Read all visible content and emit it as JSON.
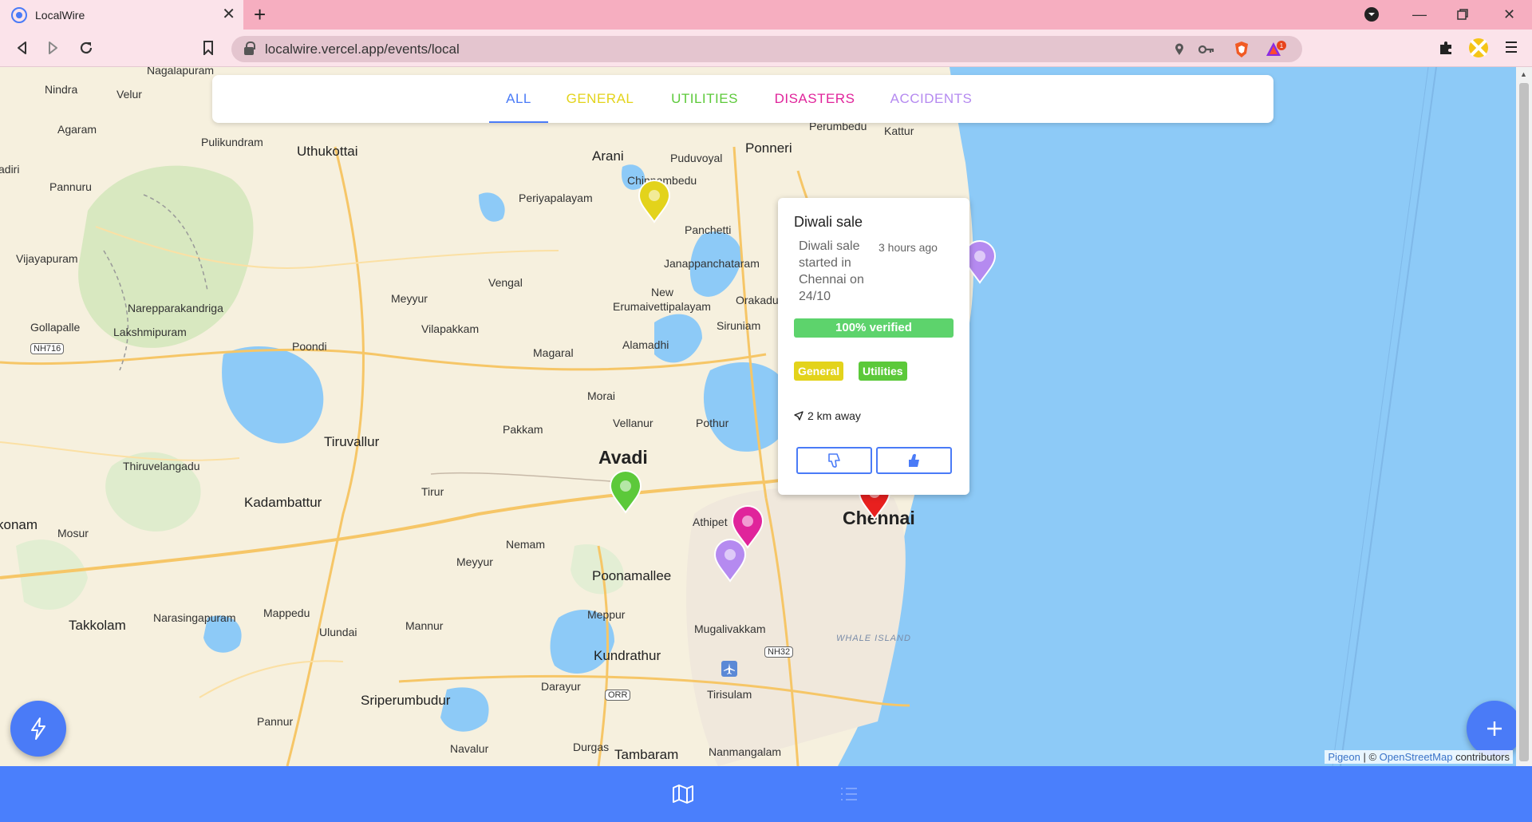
{
  "browser": {
    "tab_title": "LocalWire",
    "url": "localwire.vercel.app/events/local",
    "brave_badge": "1"
  },
  "tabs": [
    {
      "label": "ALL",
      "color": "#4a7bf7",
      "active": true
    },
    {
      "label": "GENERAL",
      "color": "#e3d31b"
    },
    {
      "label": "UTILITIES",
      "color": "#5cc93a"
    },
    {
      "label": "DISASTERS",
      "color": "#e0249b"
    },
    {
      "label": "ACCIDENTS",
      "color": "#b58af0"
    }
  ],
  "map": {
    "places": [
      "Nagalapuram",
      "Nindra",
      "Velur",
      "Agaram",
      "Pulikundram",
      "Uthukottai",
      "Arani",
      "Puduvoyal",
      "Ponneri",
      "Perumbedu",
      "Kattur",
      "adiri",
      "Pannuru",
      "Chinnambedu",
      "Periyapalayam",
      "Panchetti",
      "Vijayapuram",
      "Janappanchataram",
      "Vengal",
      "New",
      "Erumaivettipalayam",
      "Meyyur",
      "Orakadu",
      "Narepparakandriga",
      "Gollapalle",
      "Lakshmipuram",
      "Vilapakkam",
      "Siruniam",
      "Poondi",
      "Alamadhi",
      "Magaral",
      "Morai",
      "Vellanur",
      "Pothur",
      "Pakkam",
      "Tiruvallur",
      "Thiruvelangadu",
      "Avadi",
      "Tirur",
      "Kadambattur",
      "konam",
      "Mosur",
      "Athipet",
      "Chennai",
      "Nemam",
      "Meyyur",
      "Poonamallee",
      "Takkolam",
      "Narasingapuram",
      "Mappedu",
      "Mannur",
      "Ulundai",
      "Meppur",
      "Mugalivakkam",
      "WHALE ISLAND",
      "Kundrathur",
      "Darayur",
      "Tirisulam",
      "Sriperumbudur",
      "Pannur",
      "Navalur",
      "Durgas",
      "Tambaram",
      "Nanmangalam"
    ],
    "shields": [
      "NH716",
      "NH32",
      "ORR"
    ],
    "attribution": {
      "pigeon": "Pigeon",
      "sep": " | © ",
      "osm": "OpenStreetMap",
      "suffix": " contributors"
    }
  },
  "markers": [
    {
      "category": "General",
      "color": "#e3d31b"
    },
    {
      "category": "Accidents",
      "color": "#b58af0"
    },
    {
      "category": "Utilities",
      "color": "#5cc93a"
    },
    {
      "category": "Disasters",
      "color": "#e0249b"
    },
    {
      "category": "Accidents",
      "color": "#b58af0"
    },
    {
      "category": "Disasters",
      "color": "#e8201f"
    }
  ],
  "popup": {
    "title": "Diwali sale",
    "description": "Diwali sale started in Chennai on 24/10",
    "time": "3 hours ago",
    "verified": "100% verified",
    "verified_fraction": 1.0,
    "tags": [
      {
        "label": "General",
        "color": "#e3d31b"
      },
      {
        "label": "Utilities",
        "color": "#5cc93a"
      }
    ],
    "distance": "2 km away"
  },
  "icons": {
    "left_fab": "lightning-icon",
    "right_fab": "plus-icon",
    "nav_map": "map-icon",
    "nav_list": "list-icon"
  }
}
